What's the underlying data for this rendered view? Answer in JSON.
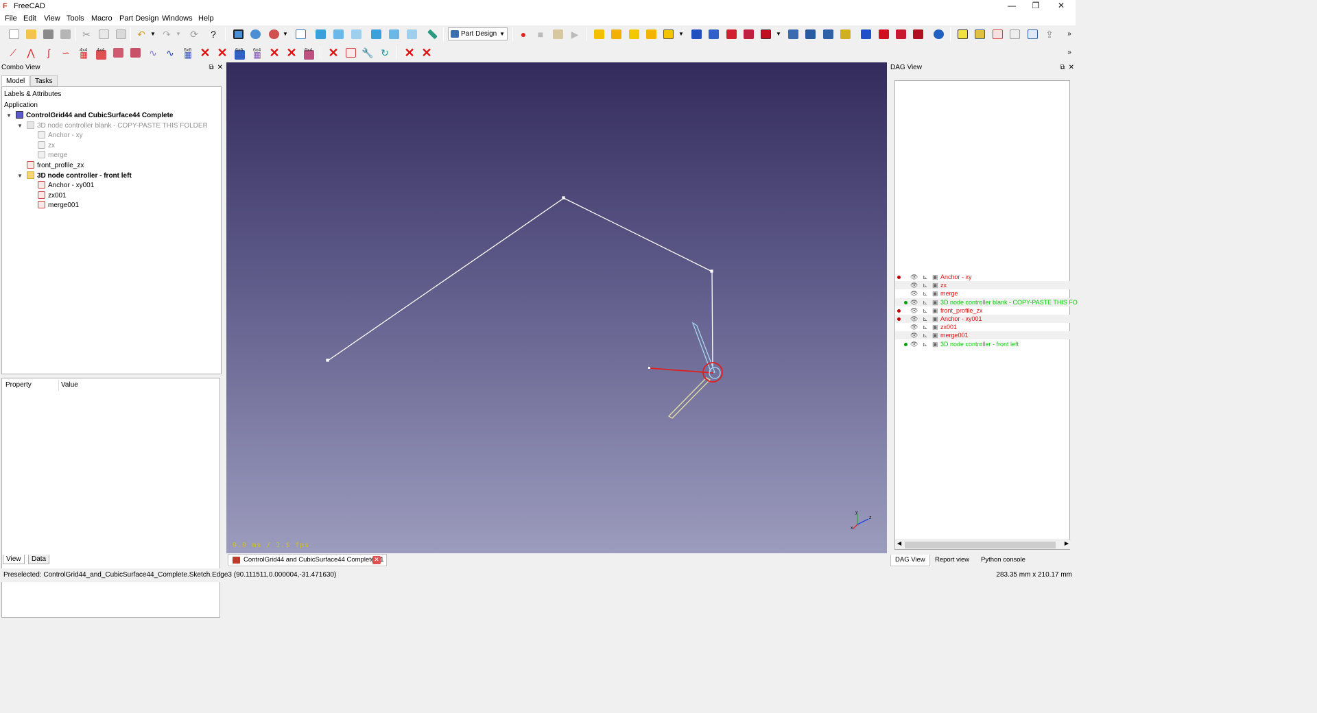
{
  "window": {
    "title": "FreeCAD"
  },
  "menu": [
    "File",
    "Edit",
    "View",
    "Tools",
    "Macro",
    "Part Design",
    "Windows",
    "Help"
  ],
  "menu_underline": [
    "F",
    "E",
    "V",
    "T",
    "M",
    "P",
    "W",
    "H"
  ],
  "toolbar": {
    "workbench_selector": "Part Design",
    "badge_4x4": "4x4",
    "badge_6x6": "6x6",
    "badge_6x4": "6x4"
  },
  "combo_view": {
    "title": "Combo View",
    "tabs": [
      "Model",
      "Tasks"
    ],
    "tree_header": "Labels & Attributes",
    "application": "Application",
    "tree": [
      {
        "label": "ControlGrid44 and CubicSurface44 Complete",
        "level": 0,
        "type": "doc",
        "style": "bold",
        "expanded": true
      },
      {
        "label": "3D node controller blank - COPY-PASTE THIS FOLDER",
        "level": 1,
        "type": "folder",
        "style": "grey",
        "expanded": true
      },
      {
        "label": "Anchor - xy",
        "level": 2,
        "type": "sketch",
        "style": "grey"
      },
      {
        "label": "zx",
        "level": 2,
        "type": "sketch",
        "style": "grey"
      },
      {
        "label": "merge",
        "level": 2,
        "type": "sketch",
        "style": "grey"
      },
      {
        "label": "front_profile_zx",
        "level": 1,
        "type": "sketch",
        "style": "normal"
      },
      {
        "label": "3D node controller  - front left",
        "level": 1,
        "type": "folder",
        "style": "bold",
        "expanded": true
      },
      {
        "label": "Anchor - xy001",
        "level": 2,
        "type": "sketch",
        "style": "normal"
      },
      {
        "label": "zx001",
        "level": 2,
        "type": "sketch",
        "style": "normal"
      },
      {
        "label": "merge001",
        "level": 2,
        "type": "sketch",
        "style": "normal"
      }
    ],
    "property_headers": [
      "Property",
      "Value"
    ],
    "bottom_tabs": [
      "View",
      "Data"
    ]
  },
  "viewport": {
    "fps": "0.0 ms / 1.$ fps",
    "document_tab": "ControlGrid44 and CubicSurface44 Complete : 1",
    "axis_labels": {
      "y": "y",
      "z": "z",
      "x": "x"
    }
  },
  "dag_view": {
    "title": "DAG View",
    "rows": [
      {
        "label": "Anchor - xy",
        "color": "#e01010",
        "dot": "#c00000"
      },
      {
        "label": "zx",
        "color": "#e01010",
        "dot": null
      },
      {
        "label": "merge",
        "color": "#e01010",
        "dot": null
      },
      {
        "label": "3D node controller blank - COPY-PASTE THIS FO",
        "color": "#00d000",
        "dot": "#00a000"
      },
      {
        "label": "front_profile_zx",
        "color": "#e01010",
        "dot": "#c00000"
      },
      {
        "label": "Anchor - xy001",
        "color": "#e01010",
        "dot": "#c00000"
      },
      {
        "label": "zx001",
        "color": "#e01010",
        "dot": null
      },
      {
        "label": "merge001",
        "color": "#e01010",
        "dot": null
      },
      {
        "label": "3D node controller  - front left",
        "color": "#00d000",
        "dot": "#00a000"
      }
    ],
    "bottom_tabs": [
      "DAG View",
      "Report view",
      "Python console"
    ]
  },
  "status": {
    "message": "Preselected: ControlGrid44_and_CubicSurface44_Complete.Sketch.Edge3 (90.111511,0.000004,-31.471630)",
    "dimensions": "283.35 mm x 210.17 mm"
  },
  "colors": {
    "viewport_top": "#332b5c",
    "viewport_bottom": "#9c9cbe",
    "sketch_red": "#e01010",
    "folder_green": "#00d000"
  }
}
